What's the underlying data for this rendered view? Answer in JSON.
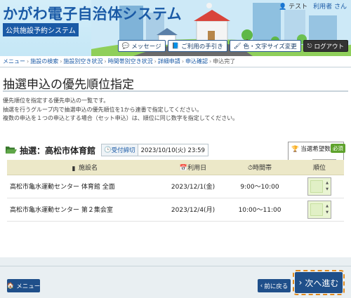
{
  "header": {
    "system_title": "かがわ電子自治体システム",
    "system_subtitle": "公共施設予約システム",
    "test_label": "テスト",
    "user_name": "利用者 さん",
    "buttons": [
      {
        "label": "メッセージ",
        "icon": "message-icon"
      },
      {
        "label": "ご利用の手引き",
        "icon": "book-icon"
      },
      {
        "label": "色・文字サイズ変更",
        "icon": "brush-icon"
      },
      {
        "label": "ログアウト",
        "icon": "logout-icon"
      }
    ]
  },
  "breadcrumb": [
    "メニュー",
    "施設の検索",
    "施設別空き状況",
    "時間帯別空き状況",
    "詳細申請",
    "申込確認",
    "申込完了"
  ],
  "page": {
    "title": "抽選申込の優先順位指定",
    "description": [
      "優先順位を指定する優先申込の一覧です。",
      "抽選を行うグループ内で抽選申込の優先順位を1から連番で指定してください。",
      "複数の申込を１つの申込とする場合（セット申込）は、順位に同じ数字を指定してください。"
    ]
  },
  "facility": {
    "name": "抽選：高松市体育館",
    "accept_label": "受付締切",
    "accept_datetime": "2023/10/10(火) 23:59",
    "win_count_label": "当選希望数",
    "required_badge": "必須"
  },
  "table": {
    "headers": [
      "施設名",
      "利用日",
      "時間帯",
      "順位"
    ],
    "rows": [
      {
        "facility": "高松市亀水運動センター 体育館 全面",
        "date": "2023/12/1(金)",
        "time": "9:00～10:00"
      },
      {
        "facility": "高松市亀水運動センター 第２集会室",
        "date": "2023/12/4(月)",
        "time": "10:00～11:00"
      }
    ]
  },
  "footer": {
    "menu_label": "メニュー",
    "back_label": "前に戻る",
    "next_label": "次へ進む"
  },
  "colors": {
    "primary": "#1f4f8a",
    "title_blue": "#1a5aa6",
    "table_header": "#ece8c8",
    "required_green": "#5ea22c",
    "focus_orange": "#e08a1e"
  }
}
